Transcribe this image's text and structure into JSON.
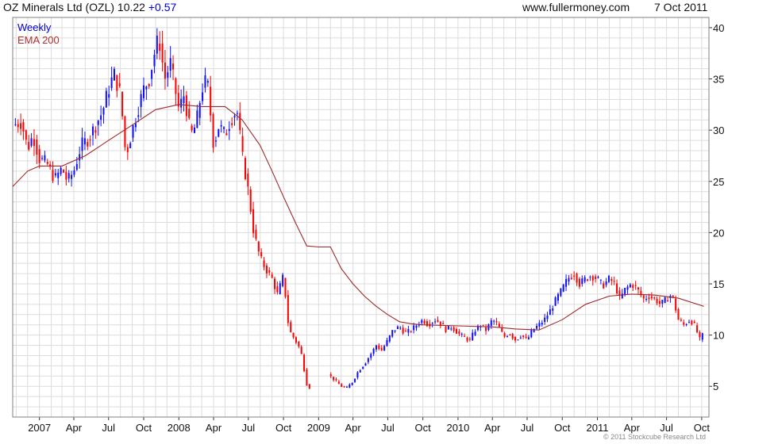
{
  "header": {
    "title": "OZ Minerals Ltd (OZL) 10.22",
    "change": "+0.57",
    "site": "www.fullermoney.com",
    "date": "7 Oct 2011"
  },
  "legend": {
    "weekly": "Weekly",
    "ema": "EMA 200"
  },
  "copyright": "© 2011 Stockcube Research Ltd",
  "colors": {
    "up": "#1010ff",
    "down": "#ff0000",
    "ema": "#9b2a2a",
    "grid": "#dcdcdc",
    "frame": "#808080"
  },
  "chart_data": {
    "type": "candlestick",
    "title": "OZ Minerals Ltd (OZL) 10.22 +0.57",
    "y_axis": {
      "position": "right",
      "range": [
        2,
        41
      ],
      "ticks": [
        5,
        10,
        15,
        20,
        25,
        30,
        35,
        40
      ]
    },
    "x_axis": {
      "range": [
        "2006-10-23",
        "2011-10-20"
      ],
      "ticks": [
        {
          "date": "2007-01-01",
          "label": "2007"
        },
        {
          "date": "2007-04-01",
          "label": "Apr"
        },
        {
          "date": "2007-07-01",
          "label": "Jul"
        },
        {
          "date": "2007-10-01",
          "label": "Oct"
        },
        {
          "date": "2008-01-01",
          "label": "2008"
        },
        {
          "date": "2008-04-01",
          "label": "Apr"
        },
        {
          "date": "2008-07-01",
          "label": "Jul"
        },
        {
          "date": "2008-10-01",
          "label": "Oct"
        },
        {
          "date": "2009-01-01",
          "label": "2009"
        },
        {
          "date": "2009-04-01",
          "label": "Apr"
        },
        {
          "date": "2009-07-01",
          "label": "Jul"
        },
        {
          "date": "2009-10-01",
          "label": "Oct"
        },
        {
          "date": "2010-01-01",
          "label": "2010"
        },
        {
          "date": "2010-04-01",
          "label": "Apr"
        },
        {
          "date": "2010-07-01",
          "label": "Jul"
        },
        {
          "date": "2010-10-01",
          "label": "Oct"
        },
        {
          "date": "2011-01-01",
          "label": "2011"
        },
        {
          "date": "2011-04-01",
          "label": "Apr"
        },
        {
          "date": "2011-07-01",
          "label": "Jul"
        },
        {
          "date": "2011-10-01",
          "label": "Oct"
        }
      ]
    },
    "grid": true,
    "series": [
      {
        "name": "Weekly",
        "kind": "price",
        "points": [
          [
            "2006-10-23",
            30.5
          ],
          [
            "2006-11-15",
            30.8
          ],
          [
            "2006-12-01",
            28.2
          ],
          [
            "2006-12-15",
            29.5
          ],
          [
            "2007-01-01",
            27.2
          ],
          [
            "2007-01-20",
            26.8
          ],
          [
            "2007-02-10",
            25.2
          ],
          [
            "2007-03-01",
            26.3
          ],
          [
            "2007-03-15",
            25.0
          ],
          [
            "2007-04-01",
            26.0
          ],
          [
            "2007-04-20",
            28.5
          ],
          [
            "2007-05-10",
            29.2
          ],
          [
            "2007-06-01",
            30.8
          ],
          [
            "2007-06-15",
            31.8
          ],
          [
            "2007-07-01",
            34.0
          ],
          [
            "2007-07-15",
            35.5
          ],
          [
            "2007-08-01",
            33.5
          ],
          [
            "2007-08-15",
            27.5
          ],
          [
            "2007-09-01",
            30.0
          ],
          [
            "2007-09-15",
            32.0
          ],
          [
            "2007-10-01",
            34.0
          ],
          [
            "2007-10-15",
            35.0
          ],
          [
            "2007-11-01",
            38.0
          ],
          [
            "2007-11-10",
            39.0
          ],
          [
            "2007-11-25",
            35.0
          ],
          [
            "2007-12-10",
            36.5
          ],
          [
            "2008-01-01",
            32.0
          ],
          [
            "2008-01-15",
            33.5
          ],
          [
            "2008-02-01",
            29.5
          ],
          [
            "2008-02-15",
            30.5
          ],
          [
            "2008-03-01",
            34.0
          ],
          [
            "2008-03-15",
            35.0
          ],
          [
            "2008-04-01",
            28.5
          ],
          [
            "2008-04-15",
            30.5
          ],
          [
            "2008-05-01",
            29.5
          ],
          [
            "2008-05-15",
            31.0
          ],
          [
            "2008-06-01",
            32.0
          ],
          [
            "2008-06-15",
            27.5
          ],
          [
            "2008-07-01",
            24.0
          ],
          [
            "2008-07-15",
            20.0
          ],
          [
            "2008-08-01",
            17.5
          ],
          [
            "2008-08-15",
            16.5
          ],
          [
            "2008-09-01",
            15.5
          ],
          [
            "2008-09-15",
            14.0
          ],
          [
            "2008-10-01",
            15.8
          ],
          [
            "2008-10-15",
            10.5
          ],
          [
            "2008-11-01",
            9.5
          ],
          [
            "2008-11-15",
            8.5
          ],
          [
            "2008-12-01",
            5.2
          ],
          [
            "2008-12-10",
            4.8
          ],
          [
            "2009-01-25",
            6.2
          ],
          [
            "2009-02-15",
            5.5
          ],
          [
            "2009-03-01",
            5.0
          ],
          [
            "2009-03-15",
            4.8
          ],
          [
            "2009-04-01",
            5.5
          ],
          [
            "2009-04-15",
            6.5
          ],
          [
            "2009-05-01",
            7.2
          ],
          [
            "2009-05-15",
            8.0
          ],
          [
            "2009-06-01",
            9.0
          ],
          [
            "2009-06-15",
            8.5
          ],
          [
            "2009-07-01",
            9.5
          ],
          [
            "2009-07-15",
            10.5
          ],
          [
            "2009-08-01",
            10.8
          ],
          [
            "2009-08-15",
            10.2
          ],
          [
            "2009-09-01",
            10.5
          ],
          [
            "2009-09-15",
            11.0
          ],
          [
            "2009-10-01",
            11.5
          ],
          [
            "2009-10-15",
            11.0
          ],
          [
            "2009-11-01",
            11.5
          ],
          [
            "2009-11-15",
            11.2
          ],
          [
            "2009-12-01",
            10.5
          ],
          [
            "2009-12-15",
            10.8
          ],
          [
            "2010-01-01",
            10.2
          ],
          [
            "2010-01-15",
            9.8
          ],
          [
            "2010-02-01",
            9.5
          ],
          [
            "2010-02-15",
            10.5
          ],
          [
            "2010-03-01",
            11.0
          ],
          [
            "2010-03-15",
            10.5
          ],
          [
            "2010-04-01",
            11.5
          ],
          [
            "2010-04-15",
            11.0
          ],
          [
            "2010-05-01",
            9.8
          ],
          [
            "2010-05-15",
            10.2
          ],
          [
            "2010-06-01",
            9.5
          ],
          [
            "2010-06-15",
            10.0
          ],
          [
            "2010-07-01",
            9.5
          ],
          [
            "2010-07-15",
            10.5
          ],
          [
            "2010-08-01",
            11.0
          ],
          [
            "2010-08-15",
            11.5
          ],
          [
            "2010-09-01",
            12.5
          ],
          [
            "2010-09-15",
            13.5
          ],
          [
            "2010-10-01",
            14.5
          ],
          [
            "2010-10-15",
            15.5
          ],
          [
            "2010-11-01",
            16.0
          ],
          [
            "2010-11-15",
            15.0
          ],
          [
            "2010-12-01",
            15.5
          ],
          [
            "2010-12-15",
            15.8
          ],
          [
            "2011-01-01",
            15.5
          ],
          [
            "2011-01-15",
            14.8
          ],
          [
            "2011-02-01",
            15.5
          ],
          [
            "2011-02-15",
            15.0
          ],
          [
            "2011-03-01",
            13.5
          ],
          [
            "2011-03-15",
            14.5
          ],
          [
            "2011-04-01",
            15.0
          ],
          [
            "2011-04-15",
            14.5
          ],
          [
            "2011-05-01",
            13.5
          ],
          [
            "2011-05-15",
            13.8
          ],
          [
            "2011-06-01",
            13.5
          ],
          [
            "2011-06-15",
            13.0
          ],
          [
            "2011-07-01",
            13.5
          ],
          [
            "2011-07-15",
            14.0
          ],
          [
            "2011-08-01",
            11.5
          ],
          [
            "2011-08-15",
            11.0
          ],
          [
            "2011-09-01",
            11.5
          ],
          [
            "2011-09-15",
            10.8
          ],
          [
            "2011-09-25",
            9.5
          ],
          [
            "2011-10-07",
            10.22
          ]
        ]
      },
      {
        "name": "EMA 200",
        "kind": "line",
        "points": [
          [
            "2006-10-23",
            24.5
          ],
          [
            "2006-12-01",
            26.0
          ],
          [
            "2007-01-01",
            26.5
          ],
          [
            "2007-03-01",
            26.5
          ],
          [
            "2007-05-01",
            27.5
          ],
          [
            "2007-07-01",
            29.0
          ],
          [
            "2007-09-01",
            30.5
          ],
          [
            "2007-11-01",
            32.0
          ],
          [
            "2008-01-01",
            32.5
          ],
          [
            "2008-03-01",
            32.3
          ],
          [
            "2008-05-01",
            32.3
          ],
          [
            "2008-06-15",
            31.0
          ],
          [
            "2008-08-01",
            28.5
          ],
          [
            "2008-09-01",
            26.0
          ],
          [
            "2008-10-01",
            23.5
          ],
          [
            "2008-11-01",
            21.0
          ],
          [
            "2008-12-01",
            18.7
          ],
          [
            "2009-01-01",
            18.6
          ],
          [
            "2009-02-01",
            18.6
          ],
          [
            "2009-03-01",
            16.5
          ],
          [
            "2009-04-01",
            15.0
          ],
          [
            "2009-05-01",
            13.8
          ],
          [
            "2009-06-01",
            12.8
          ],
          [
            "2009-07-01",
            12.0
          ],
          [
            "2009-08-01",
            11.3
          ],
          [
            "2009-09-01",
            11.1
          ],
          [
            "2009-10-01",
            11.0
          ],
          [
            "2010-01-01",
            10.9
          ],
          [
            "2010-04-01",
            10.8
          ],
          [
            "2010-06-01",
            10.6
          ],
          [
            "2010-08-01",
            10.5
          ],
          [
            "2010-10-01",
            11.5
          ],
          [
            "2010-12-01",
            13.0
          ],
          [
            "2011-02-01",
            13.8
          ],
          [
            "2011-04-01",
            14.0
          ],
          [
            "2011-06-01",
            13.9
          ],
          [
            "2011-08-01",
            13.6
          ],
          [
            "2011-10-07",
            12.8
          ]
        ]
      }
    ]
  }
}
